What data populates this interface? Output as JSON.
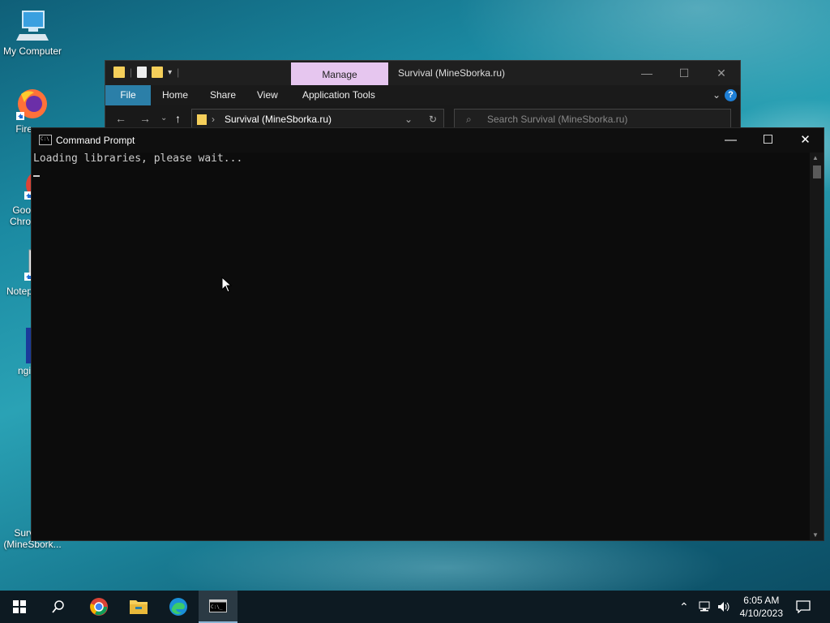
{
  "desktop": {
    "icons": [
      {
        "label": "My Computer",
        "icon": "computer-icon"
      },
      {
        "label": "Fire",
        "icon": "firefox-icon"
      },
      {
        "label": "Goo",
        "label2": "Chro",
        "icon": "chrome-icon"
      },
      {
        "label": "Notep",
        "icon": "notepad-icon"
      },
      {
        "label": "ngi",
        "icon": "app-icon"
      },
      {
        "label": "Surv",
        "label2": "(MineSbork...",
        "icon": "folder-icon"
      }
    ]
  },
  "explorer": {
    "manage_tab": "Manage",
    "title": "Survival (MineSborka.ru)",
    "ribbon_tabs": [
      "File",
      "Home",
      "Share",
      "View",
      "Application Tools"
    ],
    "address": "Survival (MineSborka.ru)",
    "search_placeholder": "Search Survival (MineSborka.ru)",
    "help": "?"
  },
  "cmd": {
    "title": "Command Prompt",
    "output_line": "Loading libraries, please wait..."
  },
  "taskbar": {
    "pinned": [
      "start-icon",
      "search-icon",
      "chrome-icon",
      "file-explorer-icon",
      "edge-icon",
      "command-prompt-icon"
    ],
    "clock_time": "6:05 AM",
    "clock_date": "4/10/2023"
  },
  "colors": {
    "manage_tab": "#e6c6ef",
    "file_tab": "#2b7fa8",
    "cmd_bg": "#0c0c0c",
    "taskbar": "#0d1a22"
  }
}
